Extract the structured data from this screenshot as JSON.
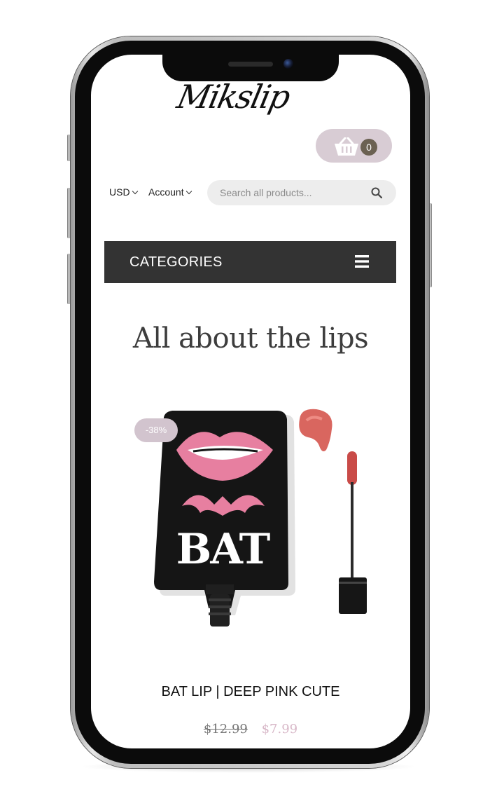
{
  "store": {
    "logo_text": "Mikslip"
  },
  "cart": {
    "count": "0",
    "icon": "basket-icon"
  },
  "header": {
    "currency": "USD",
    "account": "Account",
    "search_placeholder": "Search all products..."
  },
  "nav": {
    "categories_label": "CATEGORIES",
    "menu_icon": "hamburger-menu-icon"
  },
  "section": {
    "title": "All about the lips"
  },
  "product": {
    "discount_badge": "-38%",
    "name": "BAT LIP | DEEP PINK CUTE",
    "price_old": "$12.99",
    "price_new": "$7.99"
  },
  "colors": {
    "accent_pink": "#d8ccd4",
    "cart_count_bg": "#6b6152",
    "category_bar": "#333333",
    "sale_price": "#d8b8c8"
  }
}
